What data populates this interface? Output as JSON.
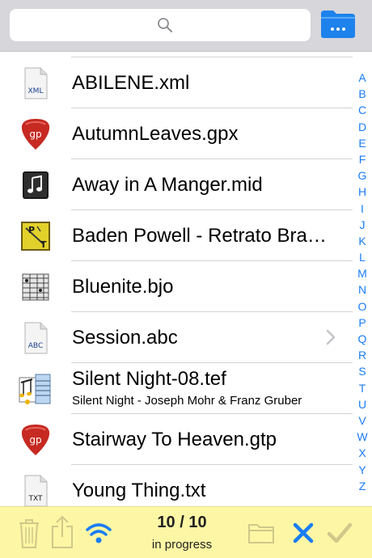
{
  "search": {
    "placeholder": ""
  },
  "files": [
    {
      "name": "ABILENE.xml",
      "subtitle": "",
      "icon": "xml-file-icon",
      "icon_label": "XML"
    },
    {
      "name": "AutumnLeaves.gpx",
      "subtitle": "",
      "icon": "guitar-pick-icon",
      "icon_label": "gp"
    },
    {
      "name": "Away in A Manger.mid",
      "subtitle": "",
      "icon": "music-note-icon",
      "icon_label": ""
    },
    {
      "name": "Baden Powell - Retrato Brasileiro",
      "subtitle": "",
      "icon": "power-tab-icon",
      "icon_label": "PT"
    },
    {
      "name": "Bluenite.bjo",
      "subtitle": "",
      "icon": "tablature-icon",
      "icon_label": ""
    },
    {
      "name": "Session.abc",
      "subtitle": "",
      "icon": "abc-file-icon",
      "icon_label": "ABC"
    },
    {
      "name": "Silent Night-08.tef",
      "subtitle": "Silent Night - Joseph Mohr & Franz Gruber",
      "icon": "tef-file-icon",
      "icon_label": ""
    },
    {
      "name": "Stairway To Heaven.gtp",
      "subtitle": "",
      "icon": "guitar-pick-icon",
      "icon_label": "gp"
    },
    {
      "name": "Young Thing.txt",
      "subtitle": "",
      "icon": "txt-file-icon",
      "icon_label": "TXT"
    }
  ],
  "index_letters": [
    "A",
    "B",
    "C",
    "D",
    "E",
    "F",
    "G",
    "H",
    "I",
    "J",
    "K",
    "L",
    "M",
    "N",
    "O",
    "P",
    "Q",
    "R",
    "S",
    "T",
    "U",
    "V",
    "W",
    "X",
    "Y",
    "Z"
  ],
  "toolbar": {
    "progress_count": "10 / 10",
    "progress_label": "in progress"
  },
  "colors": {
    "accent": "#1a7cf5",
    "toolbar_bg": "#fdf7a5",
    "guitar_pick": "#c62a22"
  }
}
